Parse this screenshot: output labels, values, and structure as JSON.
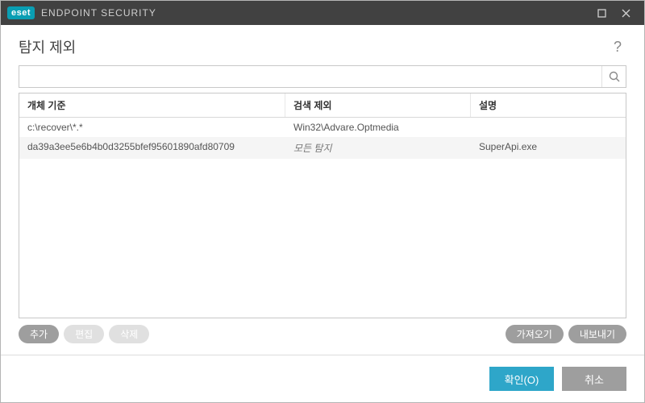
{
  "titlebar": {
    "logo_badge": "eset",
    "product_name": "ENDPOINT SECURITY"
  },
  "header": {
    "title": "탐지 제외",
    "help_label": "?"
  },
  "search": {
    "value": ""
  },
  "table": {
    "columns": [
      "개체 기준",
      "검색 제외",
      "설명"
    ],
    "rows": [
      {
        "criteria": "c:\\recover\\*.*",
        "detection": "Win32\\Advare.Optmedia",
        "comment": "",
        "all_detections": false
      },
      {
        "criteria": "da39a3ee5e6b4b0d3255bfef95601890afd80709",
        "detection": "모든 탐지",
        "comment": "SuperApi.exe",
        "all_detections": true
      }
    ]
  },
  "toolbar": {
    "add_label": "추가",
    "edit_label": "편집",
    "delete_label": "삭제",
    "import_label": "가져오기",
    "export_label": "내보내기"
  },
  "footer": {
    "ok_label": "확인(O)",
    "cancel_label": "취소"
  }
}
